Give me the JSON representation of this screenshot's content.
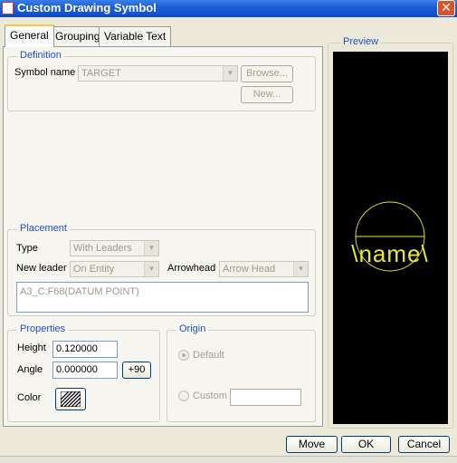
{
  "window": {
    "title": "Custom Drawing Symbol",
    "close_glyph": "✕"
  },
  "tabs": [
    {
      "label": "General",
      "active": true
    },
    {
      "label": "Grouping",
      "active": false
    },
    {
      "label": "Variable Text",
      "active": false
    }
  ],
  "definition": {
    "legend": "Definition",
    "symbol_name_label": "Symbol name",
    "symbol_name_value": "TARGET",
    "browse_label": "Browse...",
    "new_label": "New..."
  },
  "placement": {
    "legend": "Placement",
    "type_label": "Type",
    "type_value": "With Leaders",
    "new_leader_label": "New leader",
    "new_leader_value": "On Entity",
    "arrowhead_label": "Arrowhead",
    "arrowhead_value": "Arrow Head",
    "reference_text": "A3_C:F68(DATUM POINT)"
  },
  "properties": {
    "legend": "Properties",
    "height_label": "Height",
    "height_value": "0.120000",
    "angle_label": "Angle",
    "angle_value": "0.000000",
    "plus90_label": "+90",
    "color_label": "Color"
  },
  "origin": {
    "legend": "Origin",
    "default_label": "Default",
    "custom_label": "Custom",
    "custom_value": ""
  },
  "preview": {
    "legend": "Preview",
    "symbol_text": "\\name\\",
    "stroke_color": "#e8e830",
    "background": "#000000"
  },
  "footer": {
    "move_label": "Move",
    "ok_label": "OK",
    "cancel_label": "Cancel"
  },
  "colors": {
    "titlebar": "#1f5fd6",
    "legend_text": "#1f4fc8",
    "dialog_bg": "#ece9d8"
  }
}
